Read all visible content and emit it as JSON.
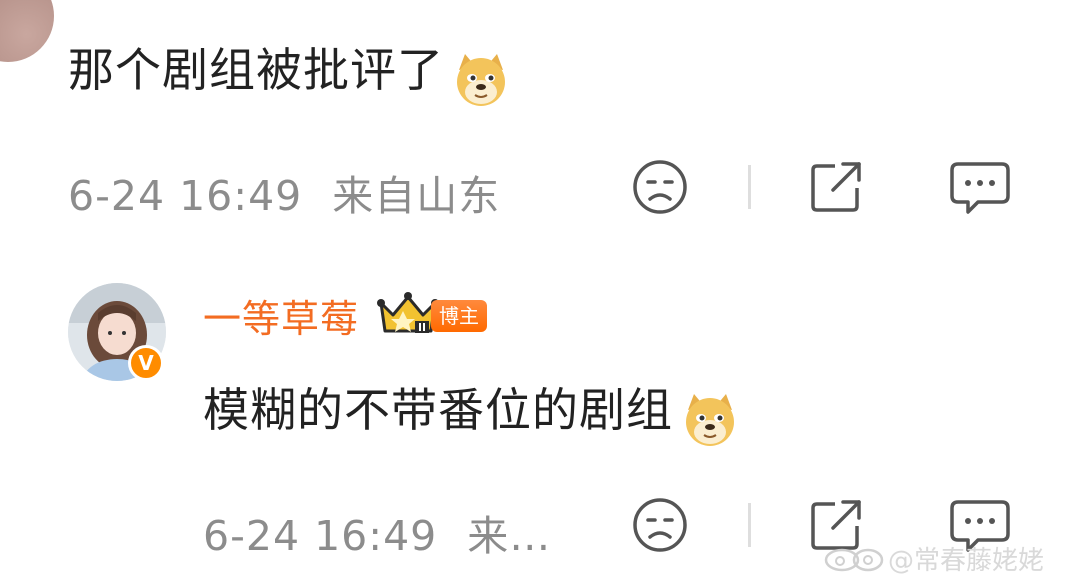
{
  "comment1": {
    "text": "那个剧组被批评了",
    "time": "6-24 16:49",
    "location": "来自山东"
  },
  "comment2": {
    "username": "一等草莓",
    "badge_label": "博主",
    "verified_mark": "V",
    "text": "模糊的不带番位的剧组",
    "time": "6-24 16:49",
    "location_truncated": "来…"
  },
  "watermark": {
    "text": "@常春藤姥姥"
  },
  "icons": {
    "dislike": "sad-face-icon",
    "share": "share-icon",
    "comment": "comment-icon",
    "emoji": "doge-emoji",
    "rank": "crown-icon"
  },
  "colors": {
    "username": "#f36c22",
    "meta": "#8c8c8c",
    "text": "#222222",
    "badge": "#ff6a00"
  }
}
